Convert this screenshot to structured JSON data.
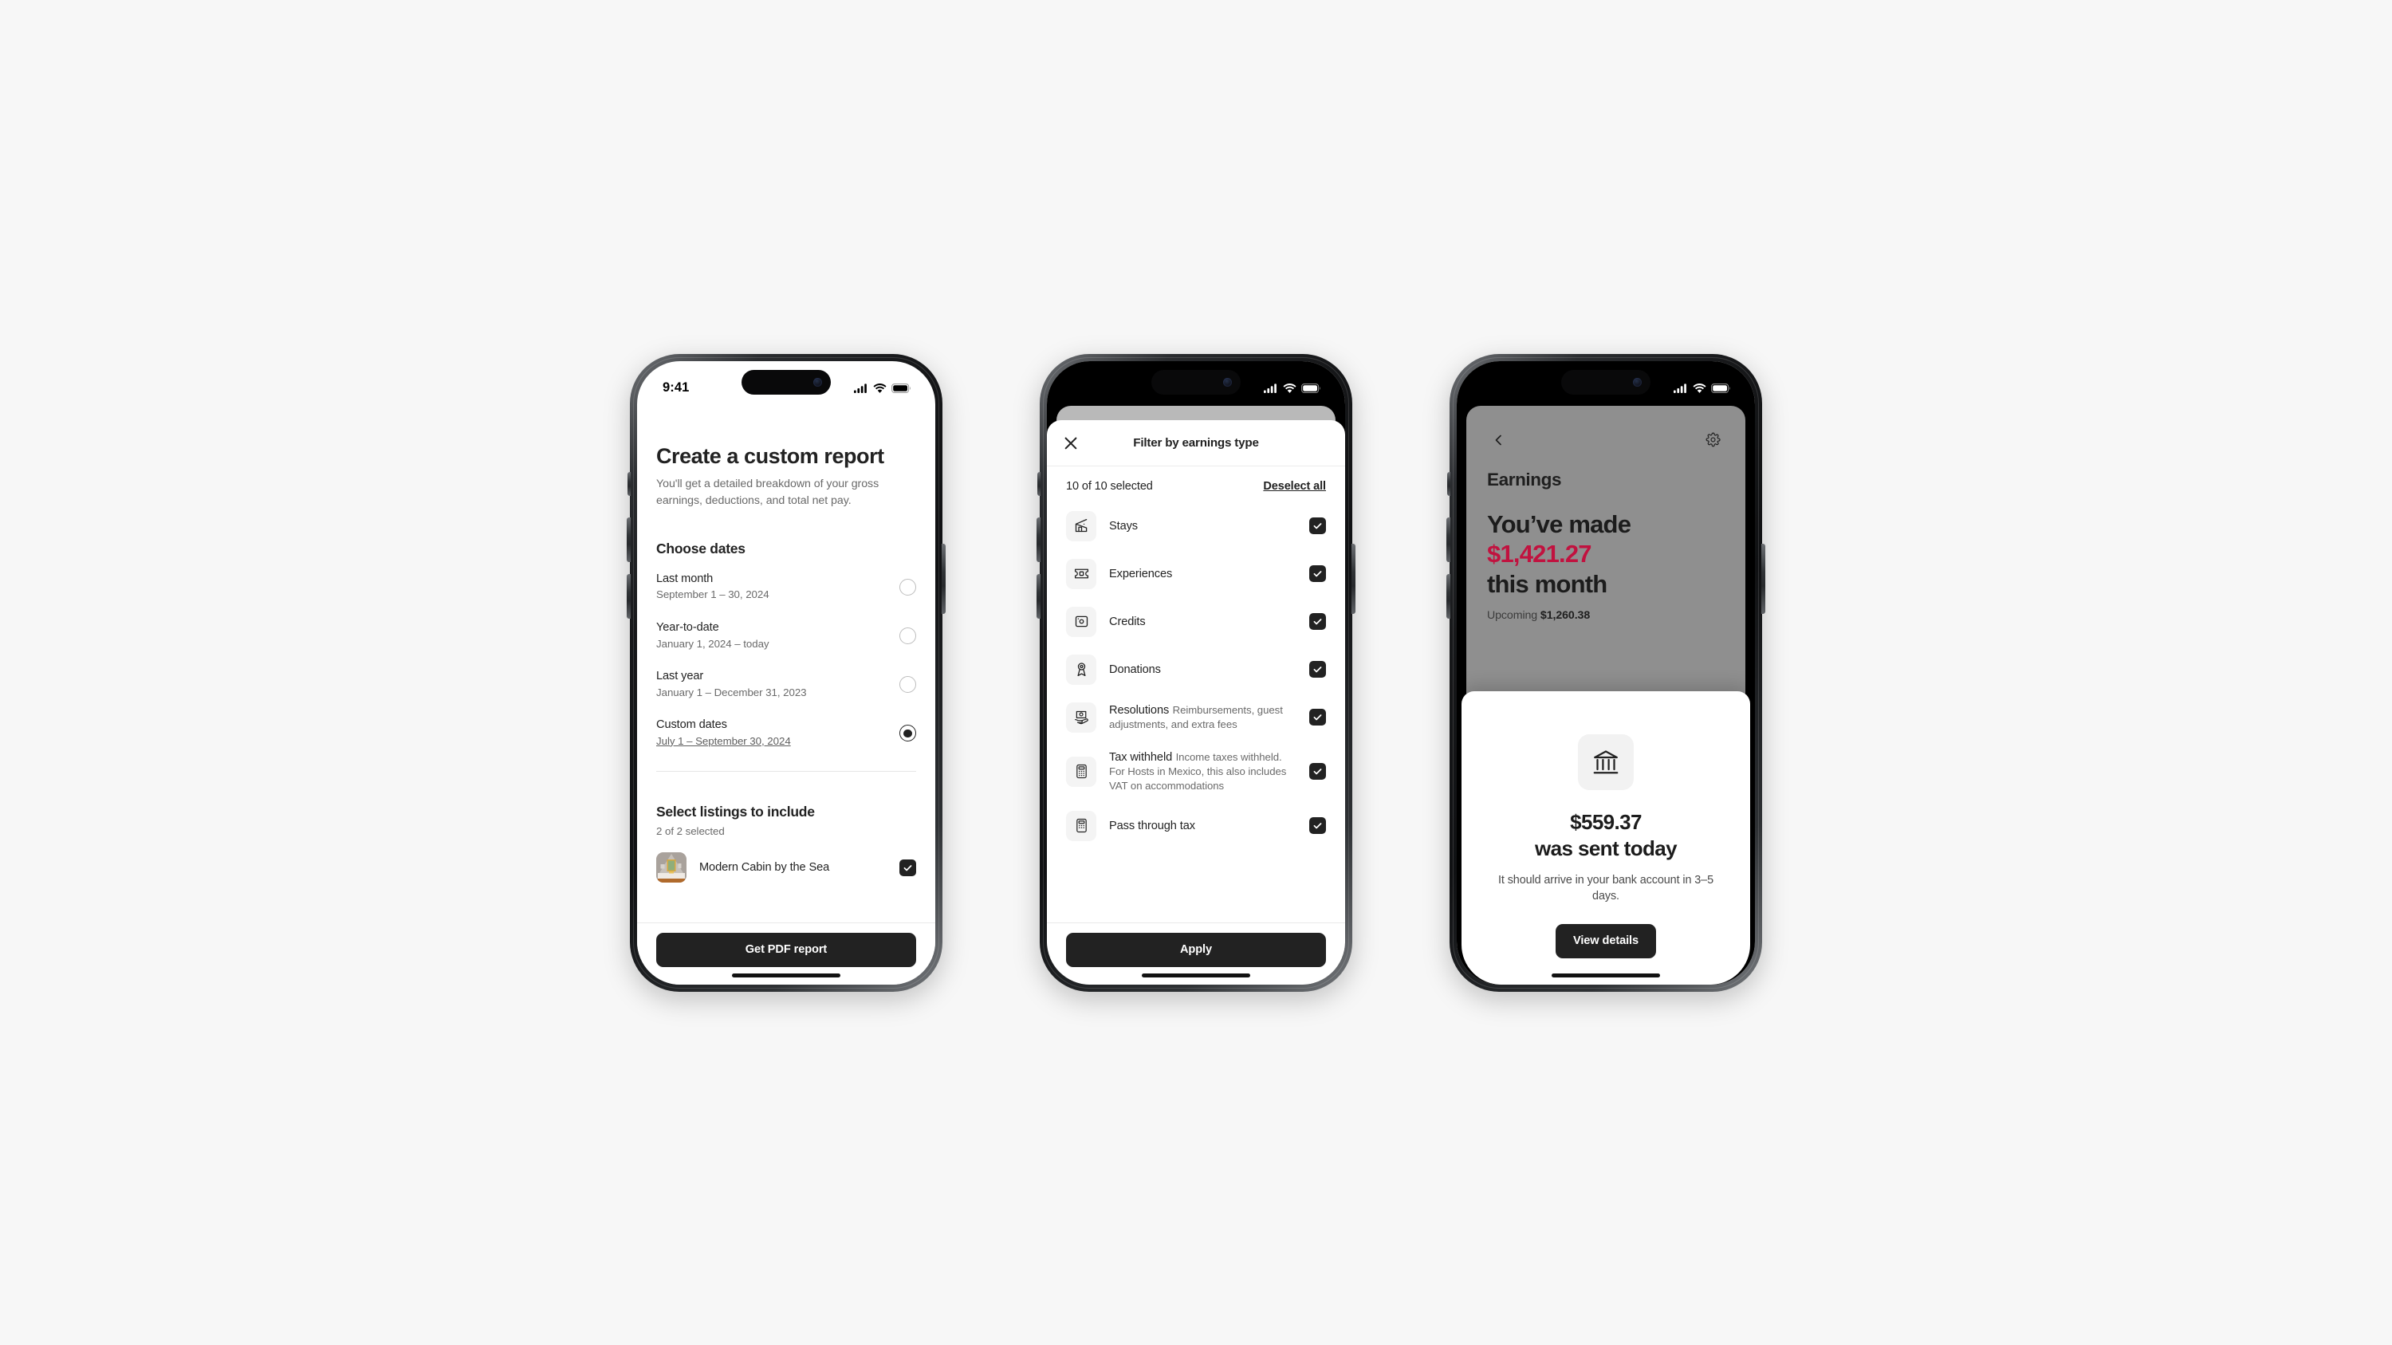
{
  "statusbar": {
    "time": "9:41",
    "cellular_icon": "cellular-signal-icon",
    "wifi_icon": "wifi-icon",
    "battery_icon": "battery-icon"
  },
  "phone1": {
    "close_icon": "close-icon",
    "title": "Create a custom report",
    "subtitle": "You'll get a detailed breakdown of your gross earnings, deductions, and total net pay.",
    "dates_heading": "Choose dates",
    "date_options": [
      {
        "label": "Last month",
        "desc": "September 1 – 30, 2024",
        "selected": false,
        "underline": false
      },
      {
        "label": "Year-to-date",
        "desc": "January 1, 2024 – today",
        "selected": false,
        "underline": false
      },
      {
        "label": "Last year",
        "desc": "January 1 – December 31, 2023",
        "selected": false,
        "underline": false
      },
      {
        "label": "Custom dates",
        "desc": "July 1 – September 30, 2024",
        "selected": true,
        "underline": true
      }
    ],
    "listings_heading": "Select listings to include",
    "listings_count": "2 of 2 selected",
    "listings": [
      {
        "name": "Modern Cabin by the Sea",
        "checked": true,
        "thumb_icon": "listing-thumbnail"
      }
    ],
    "cta_label": "Get PDF report"
  },
  "phone2": {
    "close_icon": "close-icon",
    "sheet_title": "Filter by earnings type",
    "selected_count": "10 of 10 selected",
    "deselect_label": "Deselect all",
    "filters": [
      {
        "label": "Stays",
        "desc": "",
        "icon": "house-icon",
        "checked": true
      },
      {
        "label": "Experiences",
        "desc": "",
        "icon": "ticket-icon",
        "checked": true
      },
      {
        "label": "Credits",
        "desc": "",
        "icon": "credit-card-icon",
        "checked": true
      },
      {
        "label": "Donations",
        "desc": "",
        "icon": "ribbon-icon",
        "checked": true
      },
      {
        "label": "Resolutions",
        "desc": "Reimbursements, guest adjustments, and extra fees",
        "icon": "hand-receipt-icon",
        "checked": true
      },
      {
        "label": "Tax withheld",
        "desc": "Income taxes withheld. For Hosts in Mexico, this also includes VAT on accommodations",
        "icon": "calculator-icon",
        "checked": true
      },
      {
        "label": "Pass through tax",
        "desc": "",
        "icon": "calculator-icon",
        "checked": true
      }
    ],
    "cta_label": "Apply"
  },
  "phone3": {
    "back_icon": "chevron-left-icon",
    "settings_icon": "gear-icon",
    "page_title": "Earnings",
    "made_line1": "You’ve made",
    "made_amount": "$1,421.27",
    "made_line2": "this month",
    "upcoming_label": "Upcoming",
    "upcoming_amount": "$1,260.38",
    "amount_color": "#c1123f",
    "sheet": {
      "close_icon": "close-icon",
      "bank_icon": "bank-icon",
      "payout_amount": "$559.37",
      "payout_line2": "was sent today",
      "note": "It should arrive in your bank account in 3–5 days.",
      "cta_label": "View details"
    }
  }
}
